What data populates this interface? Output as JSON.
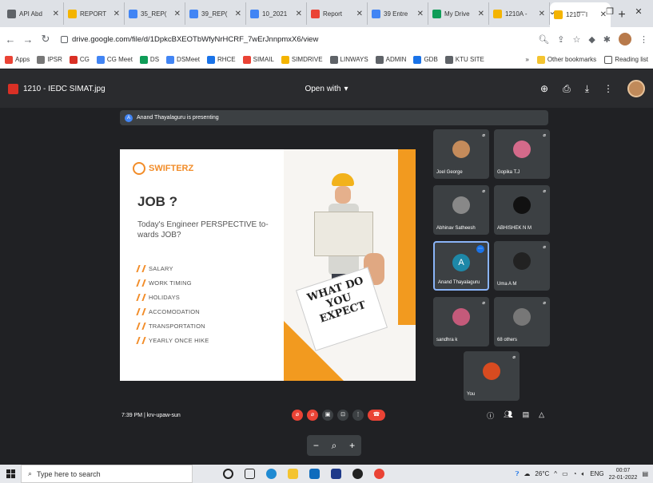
{
  "browser": {
    "tabs": [
      {
        "title": "API Abd",
        "color": "#5f6368"
      },
      {
        "title": "REPORT",
        "color": "#f4b400"
      },
      {
        "title": "35_REP(",
        "color": "#4285f4"
      },
      {
        "title": "39_REP(",
        "color": "#4285f4"
      },
      {
        "title": "10_2021",
        "color": "#4285f4"
      },
      {
        "title": "Report",
        "color": "#ea4335"
      },
      {
        "title": "39 Entre",
        "color": "#4285f4"
      },
      {
        "title": "My Drive",
        "color": "#0f9d58"
      },
      {
        "title": "1210A -",
        "color": "#f4b400"
      },
      {
        "title": "1210 - I",
        "color": "#f4b400"
      }
    ],
    "url": "drive.google.com/file/d/1DpkcBXEOTbWfyNrHCRF_7wErJnnpmxX6/view",
    "bookmarks": [
      {
        "label": "Apps",
        "color": "#ea4335"
      },
      {
        "label": "IPSR",
        "color": "#777777"
      },
      {
        "label": "CG",
        "color": "#d93025"
      },
      {
        "label": "CG Meet",
        "color": "#4285f4"
      },
      {
        "label": "DS",
        "color": "#0f9d58"
      },
      {
        "label": "DSMeet",
        "color": "#4285f4"
      },
      {
        "label": "RHCE",
        "color": "#1a73e8"
      },
      {
        "label": "SIMAIL",
        "color": "#ea4335"
      },
      {
        "label": "SIMDRIVE",
        "color": "#f4b400"
      },
      {
        "label": "LINWAYS",
        "color": "#5f6368"
      },
      {
        "label": "ADMIN",
        "color": "#5f6368"
      },
      {
        "label": "GDB",
        "color": "#1a73e8"
      },
      {
        "label": "KTU SITE",
        "color": "#5f6368"
      }
    ],
    "other_bookmarks": "Other bookmarks",
    "reading_list": "Reading list"
  },
  "viewer": {
    "file_title": "1210 - IEDC SIMAT.jpg",
    "open_with": "Open with"
  },
  "meet": {
    "presenting": "Anand Thayalaguru is presenting",
    "presenter_initial": "A",
    "time_code": "7:39 PM  |  krv-upaw-sun",
    "participants": [
      {
        "name": "Joel George",
        "avatar_color": "#c48b5b"
      },
      {
        "name": "Gopika T.J",
        "avatar_color": "#d46a8a"
      },
      {
        "name": "Abhinav Satheesh",
        "avatar_color": "#888888"
      },
      {
        "name": "ABHISHEK N M",
        "avatar_color": "#111111"
      },
      {
        "name": "Anand Thayalaguru",
        "avatar_color": "#1e88a8",
        "initial": "A"
      },
      {
        "name": "Uma A M",
        "avatar_color": "#222222"
      },
      {
        "name": "sandhra k",
        "avatar_color": "#c45a7a"
      },
      {
        "name": "68 others",
        "avatar_color": "#777777"
      },
      {
        "name": "You",
        "avatar_color": "#d84b20"
      }
    ]
  },
  "slide": {
    "brand": "SWIFTERZ",
    "title": "JOB ?",
    "subtitle": "Today's Engineer PERSPECTIVE to-wards JOB?",
    "bullets": [
      "SALARY",
      "WORK TIMING",
      "HOLIDAYS",
      "ACCOMODATION",
      "TRANSPORTATION",
      "YEARLY ONCE HIKE"
    ],
    "sign_text": "WHAT DO YOU EXPECT"
  },
  "taskbar": {
    "search_placeholder": "Type here to search",
    "weather": "26°C",
    "lang": "ENG",
    "time": "00:07",
    "date": "22-01-2022"
  }
}
